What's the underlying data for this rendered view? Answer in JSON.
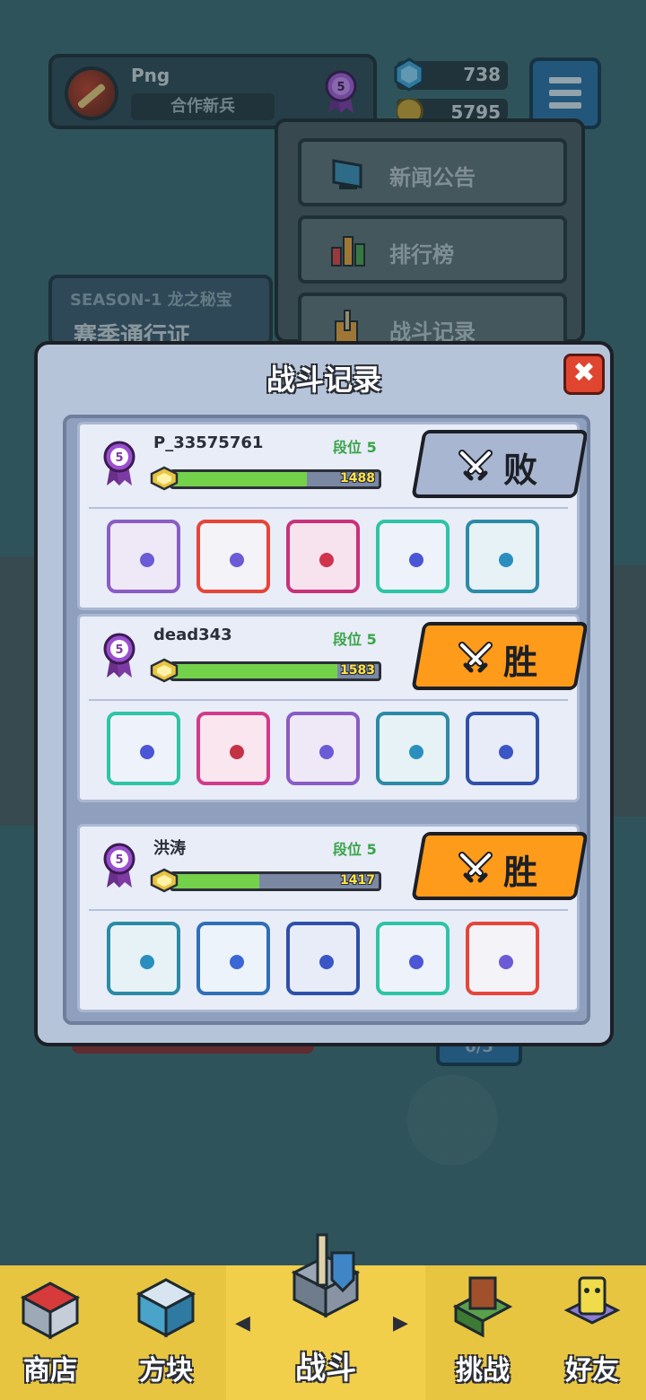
{
  "profile": {
    "name": "Png",
    "title": "合作新兵",
    "badge_level": "5"
  },
  "currency": {
    "gems": "738",
    "coins": "5795"
  },
  "menu": {
    "items": [
      {
        "label": "新闻公告",
        "icon": "monitor-icon"
      },
      {
        "label": "排行榜",
        "icon": "bar-chart-icon"
      },
      {
        "label": "战斗记录",
        "icon": "cube-sword-icon"
      }
    ]
  },
  "season": {
    "line1": "SEASON-1 龙之秘宝",
    "line2": "赛季通行证"
  },
  "behind": {
    "counter": "0/5"
  },
  "modal": {
    "title": "战斗记录",
    "close_label": "✖",
    "records": [
      {
        "name": "P_33575761",
        "rank_label": "段位 5",
        "badge_level": "5",
        "progress": 0.65,
        "score": "1488",
        "result": "败",
        "result_type": "lose",
        "dice": [
          {
            "icon": "gear-die-icon",
            "border": "#8a5cc4",
            "face": "#efe9f7",
            "pip": "#6b5bd6"
          },
          {
            "icon": "rainbow-die-icon",
            "border": "#e6453a",
            "face": "#f3f3f8",
            "pip": "#6b5bd6"
          },
          {
            "icon": "sword-die-icon",
            "border": "#c8327a",
            "face": "#f6e3ee",
            "pip": "#d0334a"
          },
          {
            "icon": "hands-die-icon",
            "border": "#2ec4a6",
            "face": "#eef3fb",
            "pip": "#4a56d6"
          },
          {
            "icon": "vortex-die-icon",
            "border": "#2b8aa6",
            "face": "#e6f2f6",
            "pip": "#2a8fbf"
          }
        ]
      },
      {
        "name": "dead343",
        "rank_label": "段位 5",
        "badge_level": "5",
        "progress": 0.8,
        "score": "1583",
        "result": "胜",
        "result_type": "win",
        "dice": [
          {
            "icon": "hands-die-icon",
            "border": "#2ec4a6",
            "face": "#eef3fb",
            "pip": "#4a56d6"
          },
          {
            "icon": "shield-die-icon",
            "border": "#d03c8c",
            "face": "#f9e6ef",
            "pip": "#c33344"
          },
          {
            "icon": "gear-die-icon",
            "border": "#8a5cc4",
            "face": "#efe9f7",
            "pip": "#6b5bd6"
          },
          {
            "icon": "vortex-die-icon",
            "border": "#2b8aa6",
            "face": "#e6f2f6",
            "pip": "#2a8fbf"
          },
          {
            "icon": "cog-die-icon",
            "border": "#2f4fa8",
            "face": "#e7ecf8",
            "pip": "#3a56c6"
          }
        ]
      },
      {
        "name": "洪涛",
        "rank_label": "段位 5",
        "badge_level": "5",
        "progress": 0.42,
        "score": "1417",
        "result": "胜",
        "result_type": "win",
        "dice": [
          {
            "icon": "wind-die-icon",
            "border": "#2b8aa6",
            "face": "#e6f2f6",
            "pip": "#2a8fbf"
          },
          {
            "icon": "snowflake-die-icon",
            "border": "#2f6fb8",
            "face": "#edf3fb",
            "pip": "#3a66d6"
          },
          {
            "icon": "cog-die-icon",
            "border": "#2f4fa8",
            "face": "#e7ecf8",
            "pip": "#3a56c6"
          },
          {
            "icon": "hands-die-icon",
            "border": "#2ec4a6",
            "face": "#eef3fb",
            "pip": "#4a56d6"
          },
          {
            "icon": "rainbow-die-icon",
            "border": "#e6453a",
            "face": "#f3f3f8",
            "pip": "#6b5bd6"
          }
        ]
      }
    ]
  },
  "nav": {
    "tabs": [
      {
        "label": "商店",
        "icon": "shop-icon",
        "active": false
      },
      {
        "label": "方块",
        "icon": "dice-box-icon",
        "active": false
      },
      {
        "label": "战斗",
        "icon": "battle-icon",
        "active": true
      },
      {
        "label": "挑战",
        "icon": "challenge-icon",
        "active": false
      },
      {
        "label": "好友",
        "icon": "friends-icon",
        "active": false
      }
    ]
  }
}
